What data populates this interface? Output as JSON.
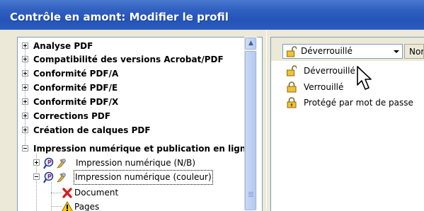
{
  "window": {
    "title": "Contrôle en amont: Modifier le profil"
  },
  "tree": {
    "items": [
      {
        "label": "Analyse PDF",
        "bold": true,
        "expander": "plus"
      },
      {
        "label": "Compatibilité des versions Acrobat/PDF",
        "bold": true,
        "expander": "plus"
      },
      {
        "label": "Conformité PDF/A",
        "bold": true,
        "expander": "plus"
      },
      {
        "label": "Conformité PDF/E",
        "bold": true,
        "expander": "plus"
      },
      {
        "label": "Conformité PDF/X",
        "bold": true,
        "expander": "plus"
      },
      {
        "label": "Corrections PDF",
        "bold": true,
        "expander": "plus"
      },
      {
        "label": "Création de calques PDF",
        "bold": true,
        "expander": "plus"
      },
      {
        "label": "Impression numérique et publication en ligne",
        "bold": true,
        "expander": "minus"
      },
      {
        "label": "Impression numérique (N/B)",
        "bold": false,
        "expander": "plus"
      },
      {
        "label": "Impression numérique (couleur)",
        "bold": false,
        "expander": "minus",
        "selected": true
      },
      {
        "label": "Document",
        "bold": false,
        "icon": "error-x-icon"
      },
      {
        "label": "Pages",
        "bold": false,
        "icon": "warning-icon"
      }
    ]
  },
  "right_panel": {
    "combo_value": "Déverrouillé",
    "name_column_label": "Nor",
    "dropdown_options": [
      {
        "label": "Déverrouillé",
        "icon": "unlocked-padlock-icon"
      },
      {
        "label": "Verrouillé",
        "icon": "locked-padlock-icon"
      },
      {
        "label": "Protégé par mot de passe",
        "icon": "password-padlock-icon"
      }
    ]
  },
  "colors": {
    "title_bar": "#2454b8",
    "dialog_bg": "#ece9d8",
    "error_red": "#d42020",
    "warning_yellow": "#f4c91e"
  }
}
